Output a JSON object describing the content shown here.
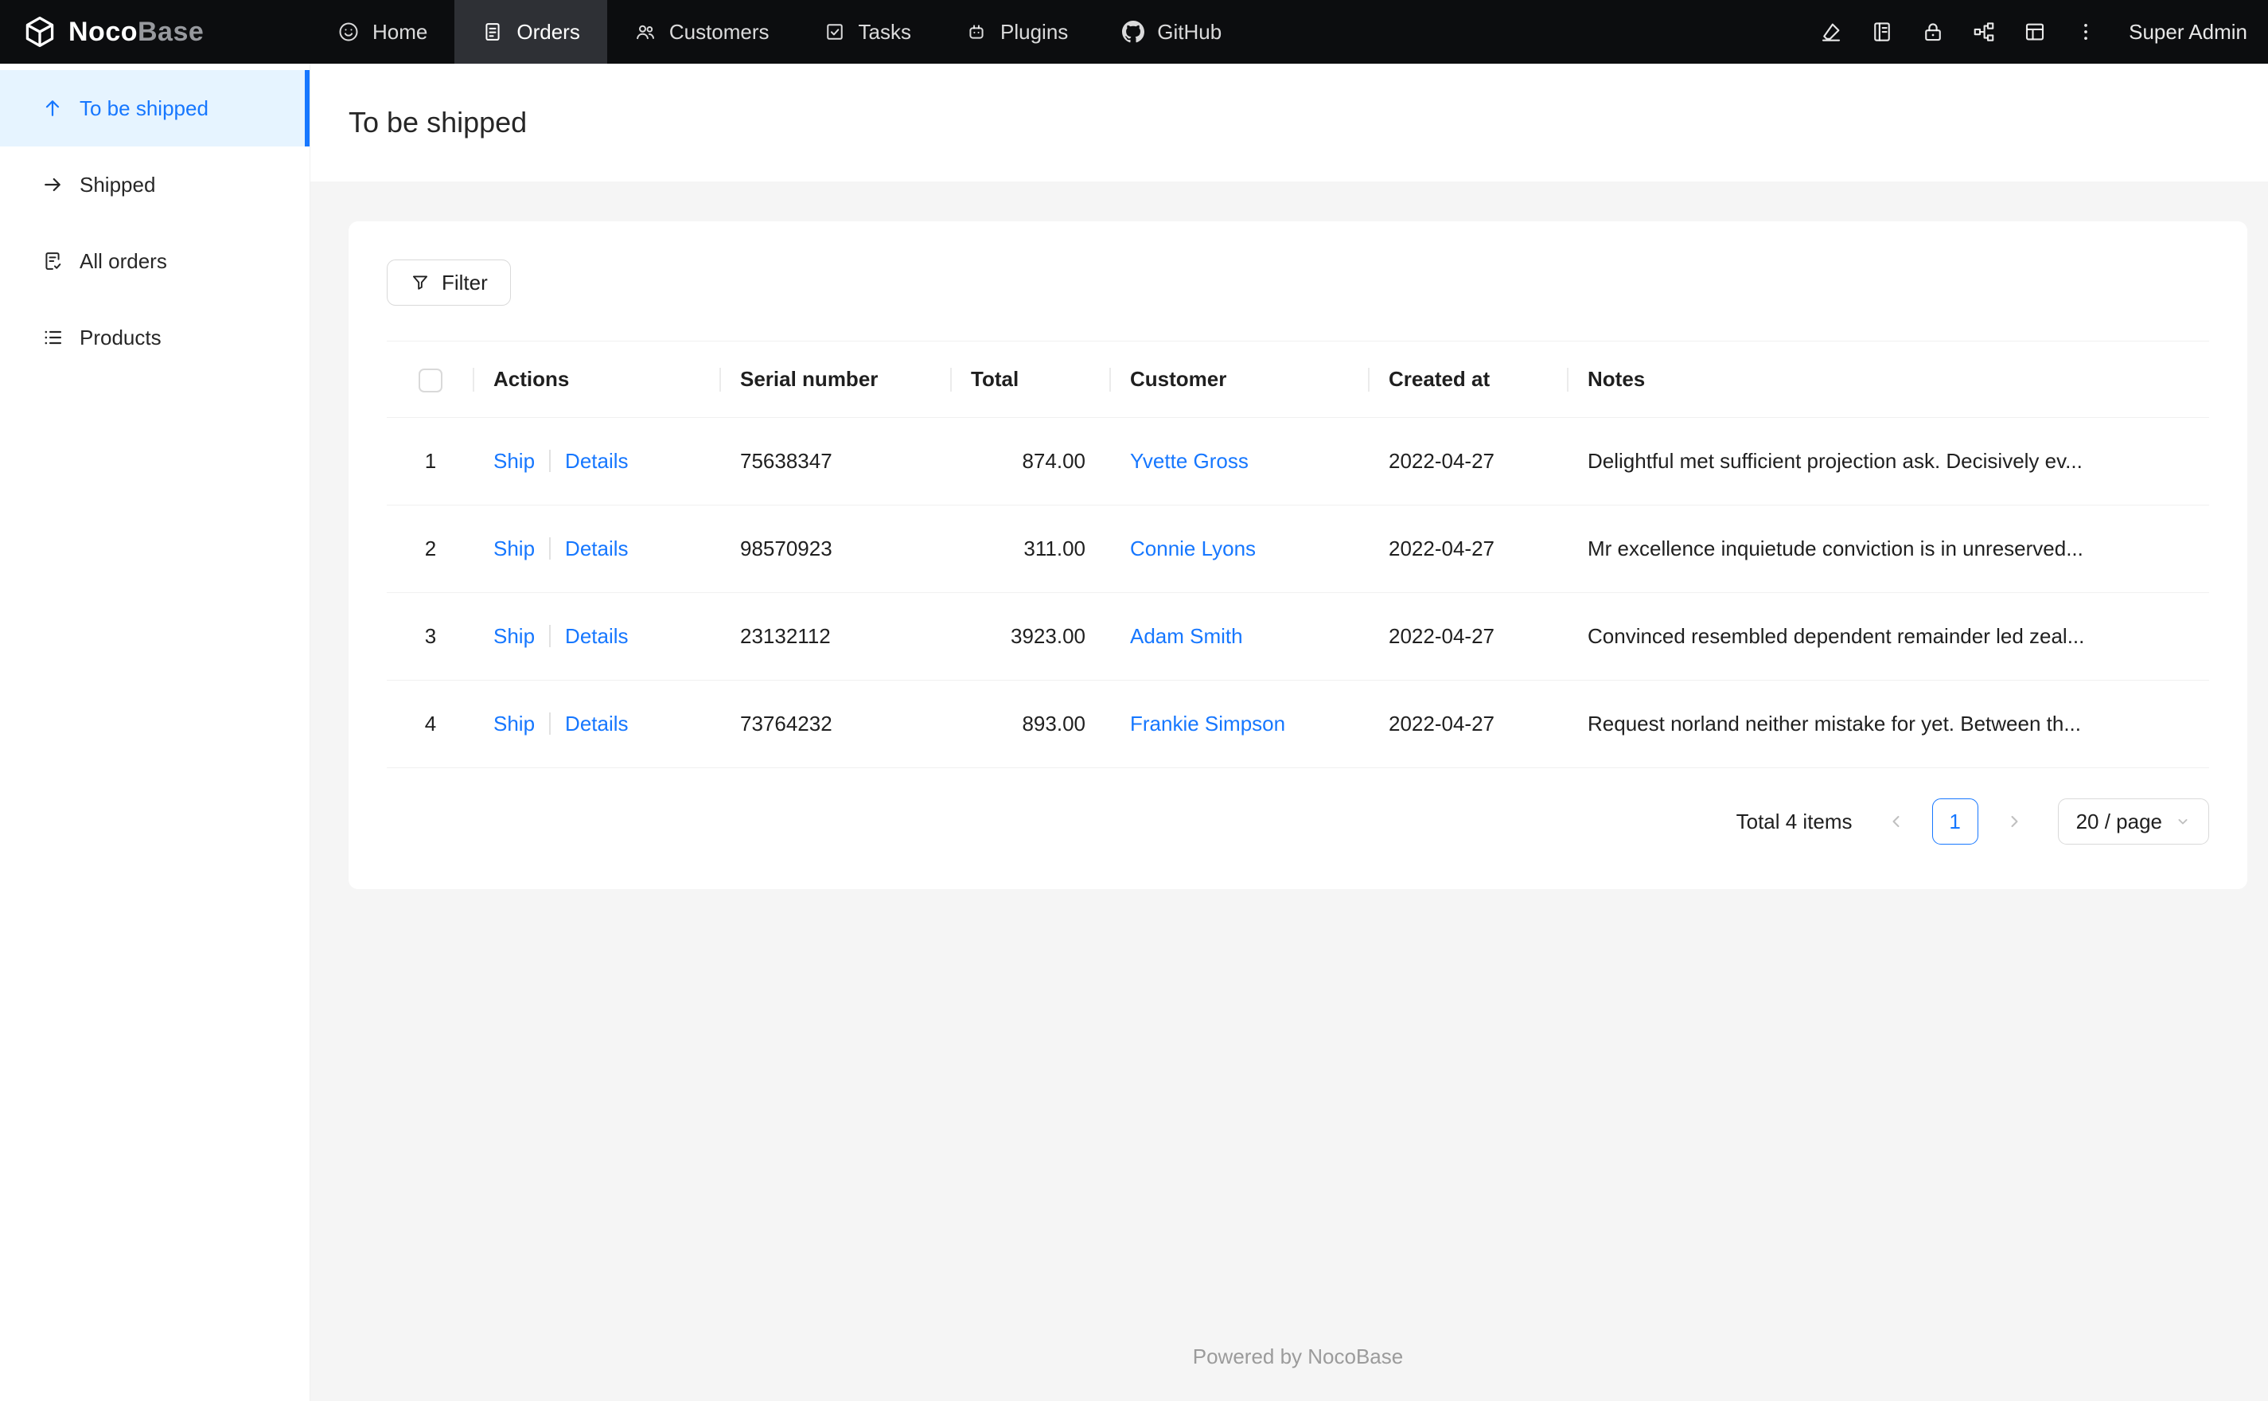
{
  "colors": {
    "accent": "#1677ff",
    "navbar_bg": "#0c0d0f",
    "navbar_active_bg": "#2e3035",
    "sidebar_active_bg": "#e6f4ff",
    "content_bg": "#f5f5f5",
    "link": "#1677ff"
  },
  "navbar": {
    "logo": {
      "primary": "Noco",
      "secondary": "Base"
    },
    "items": [
      {
        "label": "Home"
      },
      {
        "label": "Orders"
      },
      {
        "label": "Customers"
      },
      {
        "label": "Tasks"
      },
      {
        "label": "Plugins"
      },
      {
        "label": "GitHub"
      }
    ],
    "user": "Super Admin"
  },
  "sidebar": {
    "items": [
      {
        "label": "To be shipped"
      },
      {
        "label": "Shipped"
      },
      {
        "label": "All orders"
      },
      {
        "label": "Products"
      }
    ]
  },
  "page": {
    "title": "To be shipped"
  },
  "toolbar": {
    "filter": "Filter"
  },
  "table": {
    "headers": {
      "actions": "Actions",
      "serial": "Serial number",
      "total": "Total",
      "customer": "Customer",
      "created": "Created at",
      "notes": "Notes"
    },
    "rows": [
      {
        "index": "1",
        "ship": "Ship",
        "details": "Details",
        "serial": "75638347",
        "total": "874.00",
        "customer": "Yvette Gross",
        "created": "2022-04-27",
        "notes": "Delightful met sufficient projection ask. Decisively ev..."
      },
      {
        "index": "2",
        "ship": "Ship",
        "details": "Details",
        "serial": "98570923",
        "total": "311.00",
        "customer": "Connie Lyons",
        "created": "2022-04-27",
        "notes": "Mr excellence inquietude conviction is in unreserved..."
      },
      {
        "index": "3",
        "ship": "Ship",
        "details": "Details",
        "serial": "23132112",
        "total": "3923.00",
        "customer": "Adam Smith",
        "created": "2022-04-27",
        "notes": "Convinced resembled dependent remainder led zeal..."
      },
      {
        "index": "4",
        "ship": "Ship",
        "details": "Details",
        "serial": "73764232",
        "total": "893.00",
        "customer": "Frankie Simpson",
        "created": "2022-04-27",
        "notes": "Request norland neither mistake for yet. Between th..."
      }
    ]
  },
  "pagination": {
    "total": "Total 4 items",
    "page": "1",
    "size": "20 / page"
  },
  "footer": {
    "text": "Powered by NocoBase"
  }
}
